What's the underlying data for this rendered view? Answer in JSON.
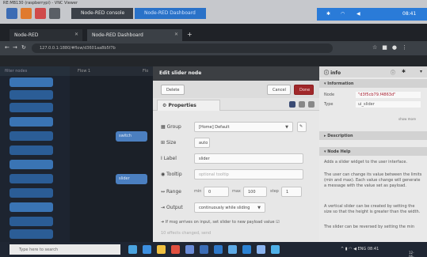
{
  "os": {
    "title": "RE:MB130 (raspberrypi) - VNC Viewer",
    "left_app": "Node-RED console",
    "right_app": "Node-RED Dashboard",
    "clock": "08:41"
  },
  "browser": {
    "tabs": [
      {
        "label": "Node-RED"
      },
      {
        "label": "Node-RED Dashboard"
      }
    ],
    "url": "127.0.0.1:1880/#flow/d3601aa8b5f7b"
  },
  "palette": {
    "filter": "filter nodes"
  },
  "workspace": {
    "tab": "Flow 1",
    "partial_tab": "Flo"
  },
  "canvas_nodes": [
    {
      "label": "switch"
    },
    {
      "label": "slider"
    }
  ],
  "dialog": {
    "title": "Edit slider node",
    "delete": "Delete",
    "cancel": "Cancel",
    "done": "Done",
    "properties_tab": "Properties",
    "group_label": "Group",
    "group_value": "[Home] Default",
    "size_label": "Size",
    "size_value": "auto",
    "label_label": "Label",
    "label_value": "slider",
    "tooltip_label": "Tooltip",
    "tooltip_placeholder": "optional tooltip",
    "range_label": "Range",
    "min_label": "min",
    "min_value": "0",
    "max_label": "max",
    "max_value": "100",
    "step_label": "step",
    "step_value": "1",
    "output_label": "Output",
    "output_value": "continuously while sliding",
    "passthrough_note": "If msg arrives on input, set slider to new payload value",
    "footer_note": "10 effects changed, send"
  },
  "sidebar": {
    "title": "info",
    "information": "Information",
    "node_key": "Node",
    "node_value": "\"d3f5cb79.f4863d\"",
    "type_key": "Type",
    "type_value": "ui_slider",
    "show_more": "show more",
    "description": "Description",
    "node_help": "Node Help",
    "help_text_1": "Adds a slider widget to the user interface.",
    "help_text_2": "The user can change its value between the limits (min and max). Each value change will generate a message with the value set as payload.",
    "help_text_3": "A vertical slider can be created by setting the size so that the height is greater than the width.",
    "help_text_4": "The slider can be reversed by setting the min"
  },
  "taskbar": {
    "search_placeholder": "Type here to search",
    "time": "08:41",
    "date": "12-06-2019"
  }
}
